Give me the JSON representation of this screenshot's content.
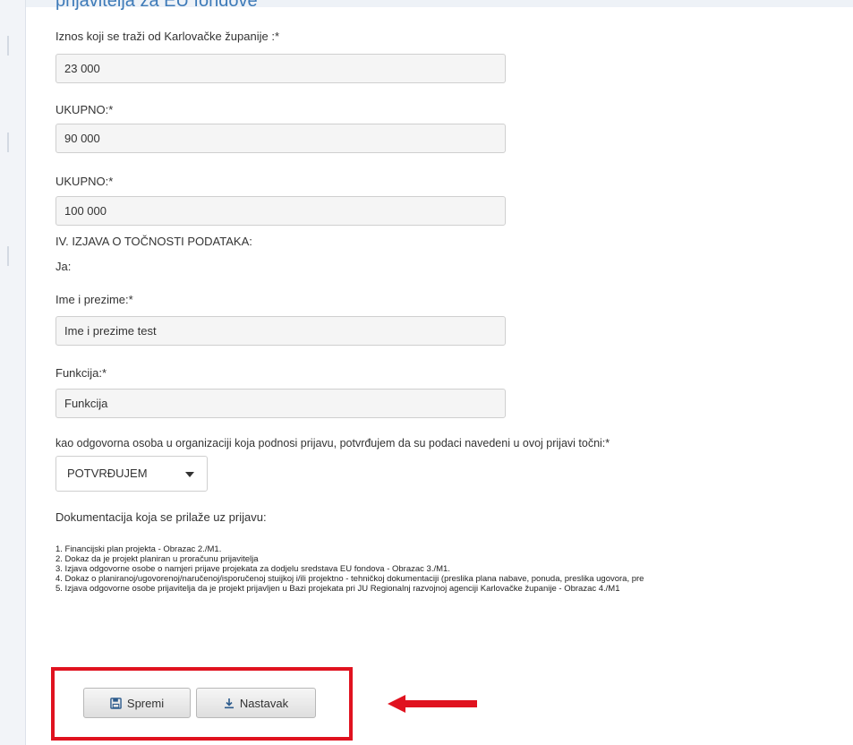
{
  "section": {
    "title": "prijavitelja za EU fondove"
  },
  "form": {
    "fields": [
      {
        "label": "Iznos koji se traži od Karlovačke županije :*",
        "value": "23 000"
      },
      {
        "label": "UKUPNO:*",
        "value": "90 000"
      },
      {
        "label": "UKUPNO:*",
        "value": "100 000"
      }
    ],
    "declaration_heading": "IV. IZJAVA O TOČNOSTI PODATAKA:",
    "ja_label": "Ja:",
    "name_field": {
      "label": "Ime i prezime:*",
      "value": "Ime i prezime test"
    },
    "function_field": {
      "label": "Funkcija:*",
      "value": "Funkcija"
    },
    "confirmation_text": "kao odgovorna osoba u organizaciji koja podnosi prijavu, potvrđujem da su podaci navedeni u ovoj prijavi točni:*",
    "confirmation_select": {
      "selected": "POTVRĐUJEM"
    },
    "documentation_heading": "Dokumentacija koja se prilaže uz prijavu:",
    "documents": [
      "1. Financijski plan projekta - Obrazac 2./M1.",
      "2. Dokaz da je projekt planiran u proračunu prijavitelja",
      "3. Izjava odgovorne osobe o namjeri prijave projekata za dodjelu sredstava EU fondova - Obrazac 3./M1.",
      "4. Dokaz o planiranoj/ugovorenoj/naručenoj/isporučenoj stuijkoj i/ili projektno - tehničkoj dokumentaciji (preslika plana nabave, ponuda, preslika ugovora, pre",
      "5. Izjava odgovorne osobe prijavitelja da je projekt prijavljen u Bazi projekata pri JU Regionalnj razvojnoj agenciji Karlovačke županije - Obrazac 4./M1"
    ]
  },
  "buttons": {
    "save": "Spremi",
    "continue": "Nastavak"
  },
  "icons": {
    "save": "floppy-disk-icon",
    "continue": "download-icon"
  },
  "colors": {
    "highlight": "#e0121f",
    "title": "#3d7ab8",
    "field_bg": "#f5f5f5"
  }
}
